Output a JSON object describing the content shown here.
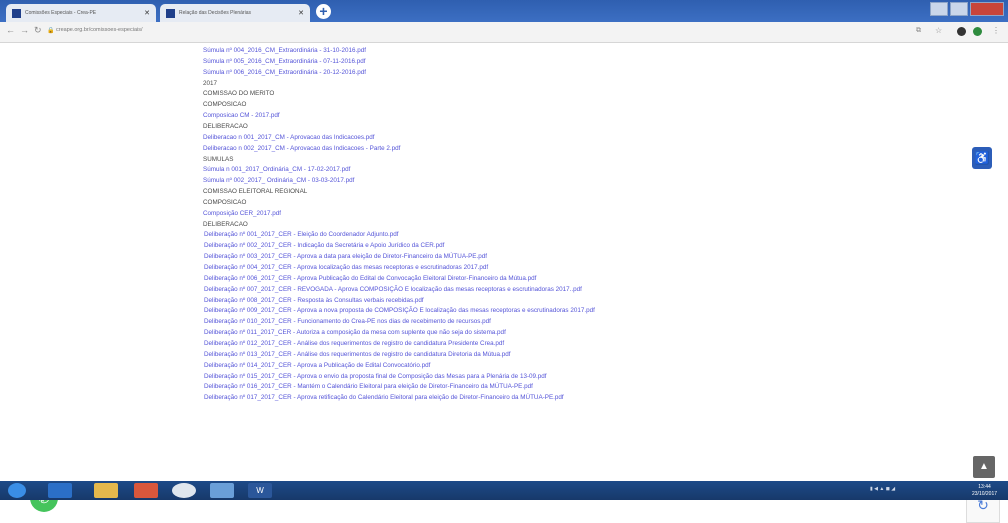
{
  "browser": {
    "tabs": [
      {
        "title": "Comissões Especiais - Crea-PE"
      },
      {
        "title": "Relação das Decisões Plenárias"
      }
    ],
    "new_tab_label": "+",
    "url": "creape.org.br/comissoes-especiais/"
  },
  "content": {
    "items": [
      {
        "text": "Súmula nº 004_2016_CM_Extraordinária - 31-10-2016.pdf",
        "kind": "link"
      },
      {
        "text": "Súmula nº 005_2016_CM_Extraordinária - 07-11-2016.pdf",
        "kind": "link"
      },
      {
        "text": "Súmula nº 006_2016_CM_Extraordinária - 20-12-2016.pdf",
        "kind": "link"
      },
      {
        "text": "2017",
        "kind": "heading"
      },
      {
        "text": "COMISSAO DO MERITO",
        "kind": "heading"
      },
      {
        "text": "COMPOSICAO",
        "kind": "heading"
      },
      {
        "text": "Composicao CM - 2017.pdf",
        "kind": "link"
      },
      {
        "text": "DELIBERACAO",
        "kind": "heading"
      },
      {
        "text": "Deliberacao n 001_2017_CM - Aprovacao das Indicacoes.pdf",
        "kind": "link"
      },
      {
        "text": "Deliberacao n 002_2017_CM - Aprovacao das Indicacoes - Parte 2.pdf",
        "kind": "link"
      },
      {
        "text": "SUMULAS",
        "kind": "heading"
      },
      {
        "text": "Súmula n 001_2017_Ordinária_CM - 17-02-2017.pdf",
        "kind": "link"
      },
      {
        "text": "Súmula nº 002_2017_ Ordinária_CM - 03-03-2017.pdf",
        "kind": "link"
      },
      {
        "text": "COMISSAO ELEITORAL REGIONAL",
        "kind": "heading"
      },
      {
        "text": "COMPOSICAO",
        "kind": "heading"
      },
      {
        "text": "Composição CER_2017.pdf",
        "kind": "link"
      },
      {
        "text": "DELIBERACAO",
        "kind": "heading"
      },
      {
        "text": "Deliberação nº 001_2017_CER - Eleição do Coordenador Adjunto.pdf",
        "kind": "link"
      },
      {
        "text": "Deliberação nº 002_2017_CER - Indicação da Secretária e Apoio Jurídico da CER.pdf",
        "kind": "link"
      },
      {
        "text": "Deliberação nº 003_2017_CER - Aprova a data para eleição de Diretor-Financeiro da MÚTUA-PE.pdf",
        "kind": "link"
      },
      {
        "text": "Deliberação nº 004_2017_CER - Aprova localização das mesas receptoras e escrutinadoras 2017.pdf",
        "kind": "link"
      },
      {
        "text": "Deliberação nº 006_2017_CER - Aprova Publicação do Edital de Convocação Eleitoral Diretor-Financeiro da Mútua.pdf",
        "kind": "link"
      },
      {
        "text": "Deliberação nº 007_2017_CER - REVOGADA - Aprova COMPOSIÇÃO E localização das mesas receptoras e escrutinadoras 2017..pdf",
        "kind": "link"
      },
      {
        "text": "Deliberação nº 008_2017_CER - Resposta às Consultas verbais recebidas.pdf",
        "kind": "link"
      },
      {
        "text": "Deliberação nº 009_2017_CER - Aprova a nova proposta de COMPOSIÇÃO E localização das mesas receptoras e escrutinadoras 2017.pdf",
        "kind": "link"
      },
      {
        "text": "Deliberação nº 010_2017_CER - Funcionamento do Crea-PE nos dias de recebimento de recursos.pdf",
        "kind": "link"
      },
      {
        "text": "Deliberação nº 011_2017_CER - Autoriza a composição da mesa com suplente que não seja do sistema.pdf",
        "kind": "link"
      },
      {
        "text": "Deliberação nº 012_2017_CER - Análise dos requerimentos de registro de candidatura Presidente Crea.pdf",
        "kind": "link"
      },
      {
        "text": "Deliberação nº 013_2017_CER - Análise dos requerimentos de registro de candidatura Diretoria da Mútua.pdf",
        "kind": "link"
      },
      {
        "text": "Deliberação nº 014_2017_CER - Aprova a Publicação de Edital Convocatório.pdf",
        "kind": "link"
      },
      {
        "text": "Deliberação nº 015_2017_CER - Aprova o envio da proposta final de Composição das Mesas para a Plenária de 13-09.pdf",
        "kind": "link"
      },
      {
        "text": "Deliberação nº 016_2017_CER - Mantém o Calendário Eleitoral para eleição de Diretor-Financeiro da MÚTUA-PE.pdf",
        "kind": "link"
      },
      {
        "text": "Deliberação nº 017_2017_CER - Aprova retificação do Calendário Eleitoral para eleição de Diretor-Financeiro da MÚTUA-PE.pdf",
        "kind": "link"
      }
    ]
  },
  "taskbar": {
    "clock_time": "13:44",
    "clock_date": "23/10/2017"
  }
}
